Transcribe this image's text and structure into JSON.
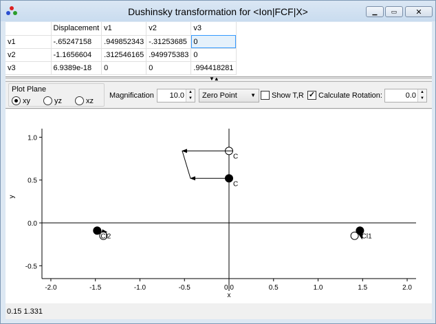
{
  "window": {
    "title": "Dushinsky transformation for <Ion|FCF|X>",
    "buttons": [
      "minimize",
      "maximize",
      "close"
    ]
  },
  "table": {
    "headers": [
      "",
      "Displacement",
      "v1",
      "v2",
      "v3"
    ],
    "rows": [
      [
        "v1",
        "-.65247158",
        ".949852343",
        "-.31253685",
        "0"
      ],
      [
        "v2",
        "-1.1656604",
        ".312546165",
        ".949975383",
        "0"
      ],
      [
        "v3",
        "6.9389e-18",
        "0",
        "0",
        ".994418281"
      ]
    ]
  },
  "controls": {
    "plot_plane_label": "Plot Plane",
    "radio_xy": "xy",
    "radio_yz": "yz",
    "radio_xz": "xz",
    "selected_plane": "xy",
    "magnification_label": "Magnification",
    "magnification_value": "10.0",
    "zero_point_option": "Zero Point",
    "show_tr_label": "Show T,R",
    "show_tr_checked": false,
    "calc_rotation_label": "Calculate Rotation:",
    "calc_rotation_checked": true,
    "rotation_value": "0.0"
  },
  "chart_data": {
    "type": "scatter",
    "xlabel": "x",
    "ylabel": "y",
    "xlim": [
      -2.1,
      2.1
    ],
    "ylim": [
      -0.65,
      1.1
    ],
    "xticks": [
      "-2.0",
      "-1.5",
      "-1.0",
      "-0.5",
      "0.0",
      "0.5",
      "1.0",
      "1.5",
      "2.0"
    ],
    "yticks": [
      "-0.5",
      "0.0",
      "0.5",
      "1.0"
    ],
    "atoms_filled": [
      {
        "label": "C",
        "x": 0.0,
        "y": 0.52
      },
      {
        "label": "Cl2",
        "x": -1.48,
        "y": -0.09
      },
      {
        "label": "Cl1",
        "x": 1.47,
        "y": -0.09
      }
    ],
    "atoms_open": [
      {
        "label": "C",
        "x": 0.0,
        "y": 0.84
      },
      {
        "label": "Cl2",
        "x": -1.41,
        "y": -0.15
      },
      {
        "label": "Cl1",
        "x": 1.41,
        "y": -0.15
      }
    ]
  },
  "status": {
    "coords": "0.15  1.331"
  }
}
